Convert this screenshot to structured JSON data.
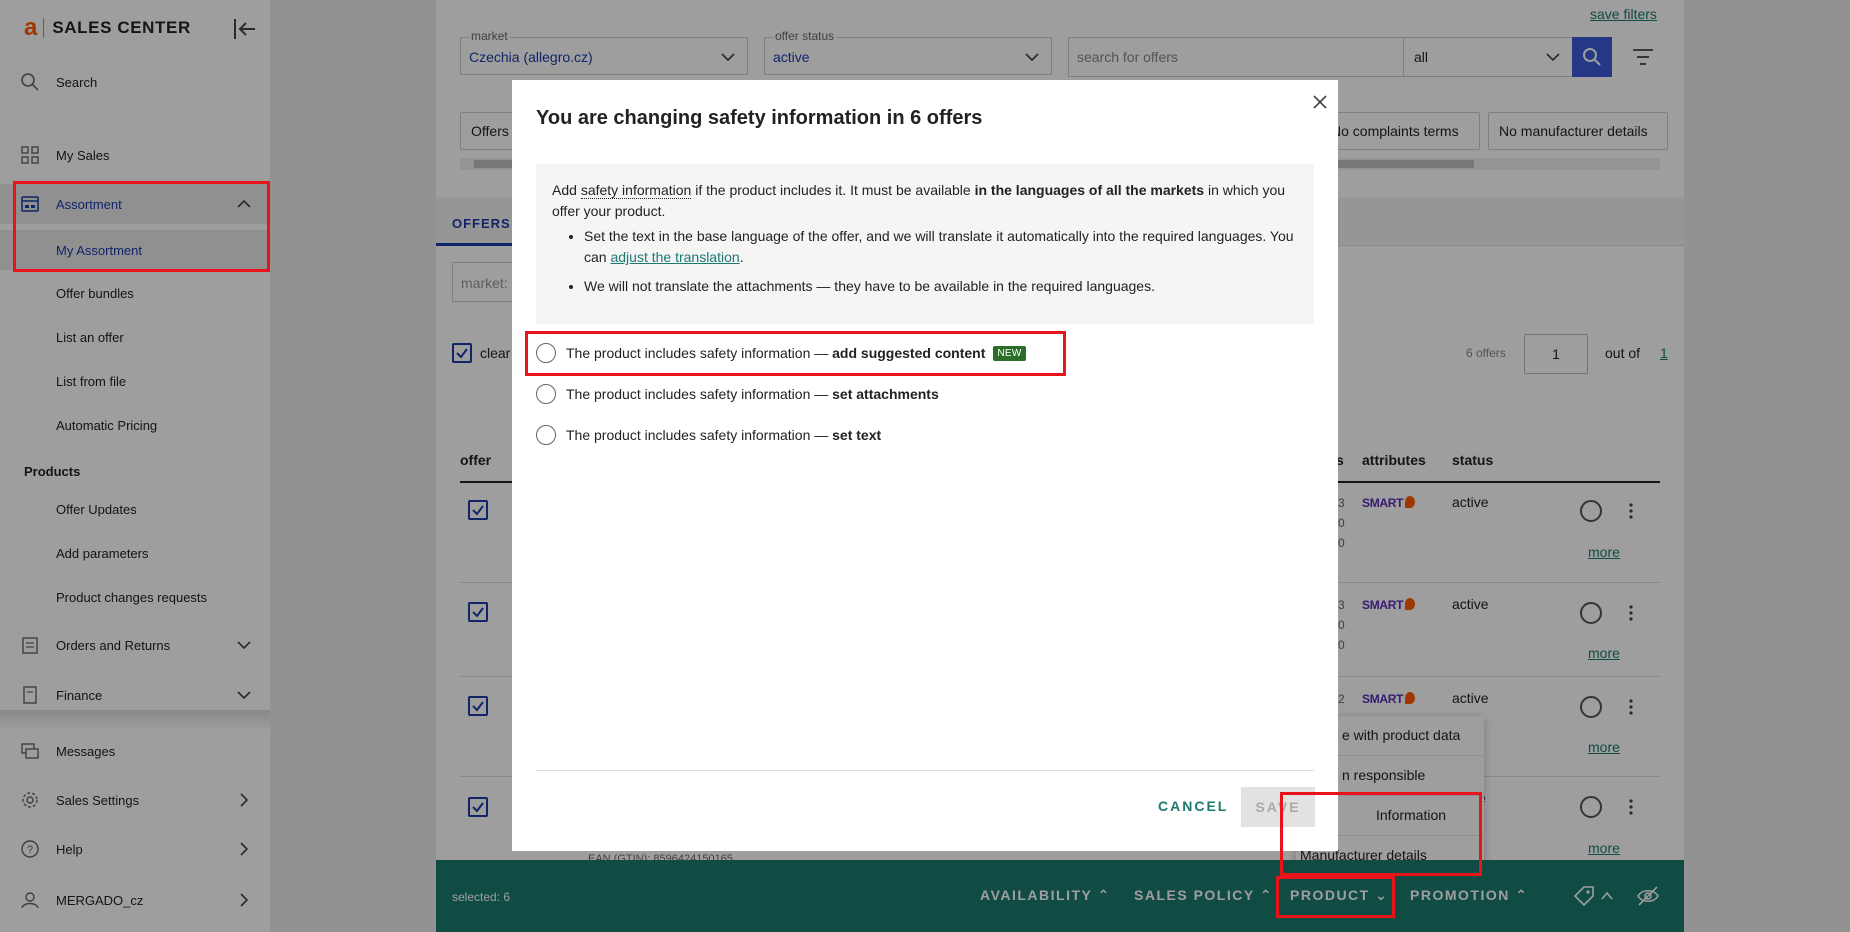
{
  "app": {
    "logo_letter": "a",
    "logo_text": "SALES CENTER"
  },
  "sidebar": {
    "search": "Search",
    "my_sales": "My Sales",
    "assortment": "Assortment",
    "assortment_items": [
      "My Assortment",
      "Offer bundles",
      "List an offer",
      "List from file",
      "Automatic Pricing"
    ],
    "products_title": "Products",
    "products_items": [
      "Offer Updates",
      "Add parameters",
      "Product changes requests"
    ],
    "orders": "Orders and Returns",
    "finance": "Finance",
    "messages": "Messages",
    "sales_settings": "Sales Settings",
    "help": "Help",
    "account": "MERGADO_cz"
  },
  "filters": {
    "save_filters": "save filters",
    "market_label": "market",
    "market_value": "Czechia (allegro.cz)",
    "status_label": "offer status",
    "status_value": "active",
    "search_placeholder": "search for offers",
    "search_scope": "all",
    "chips": [
      "Offers",
      "No complaints terms",
      "No manufacturer details"
    ]
  },
  "list": {
    "tab": "OFFERS",
    "market_placeholder": "market:",
    "clear": "clear",
    "offers_count": "6 offers",
    "page": "1",
    "out_of": "out of",
    "total_pages": "1",
    "col_offer": "offer",
    "col_partial": "s",
    "col_attributes": "attributes",
    "col_status": "status",
    "rows": [
      {
        "status": "active",
        "nums": [
          "3",
          "0",
          "0"
        ],
        "more": "more"
      },
      {
        "status": "active",
        "nums": [
          "3",
          "0",
          "0"
        ],
        "more": "more"
      },
      {
        "status": "active",
        "nums": [
          "2"
        ],
        "more": "more"
      },
      {
        "status": "e",
        "nums": [],
        "more": "more"
      }
    ],
    "smart_label": "SMART",
    "ean_partial": "EAN (GTIN): 8596424150165"
  },
  "product_menu": {
    "items": [
      "e with product data",
      "n responsible",
      "Information",
      "Manufacturer details"
    ]
  },
  "bottom_bar": {
    "selected": "selected: 6",
    "availability": "AVAILABILITY",
    "sales_policy": "SALES POLICY",
    "product": "PRODUCT",
    "promotion": "PROMOTION"
  },
  "modal": {
    "title": "You are changing safety information in 6 offers",
    "intro_1": "Add ",
    "intro_link": "safety information",
    "intro_2": " if the product includes it. It must be available ",
    "intro_bold": "in the languages of all the markets",
    "intro_3": " in which you offer your product.",
    "bullet1_a": "Set the text in the base language of the offer, and we will translate it automatically into the required languages. You can ",
    "bullet1_link": "adjust the translation",
    "bullet1_b": ".",
    "bullet2": "We will not translate the attachments — they have to be available in the required languages.",
    "option_prefix": "The product includes safety information — ",
    "option1_bold": "add suggested content",
    "option1_badge": "NEW",
    "option2_bold": "set attachments",
    "option3_bold": "set text",
    "cancel": "CANCEL",
    "save": "SAVE"
  },
  "colors": {
    "accent": "#1a3ba9",
    "teal": "#1a7a6e",
    "highlight": "#e8141c",
    "badge": "#2a6e2a"
  }
}
